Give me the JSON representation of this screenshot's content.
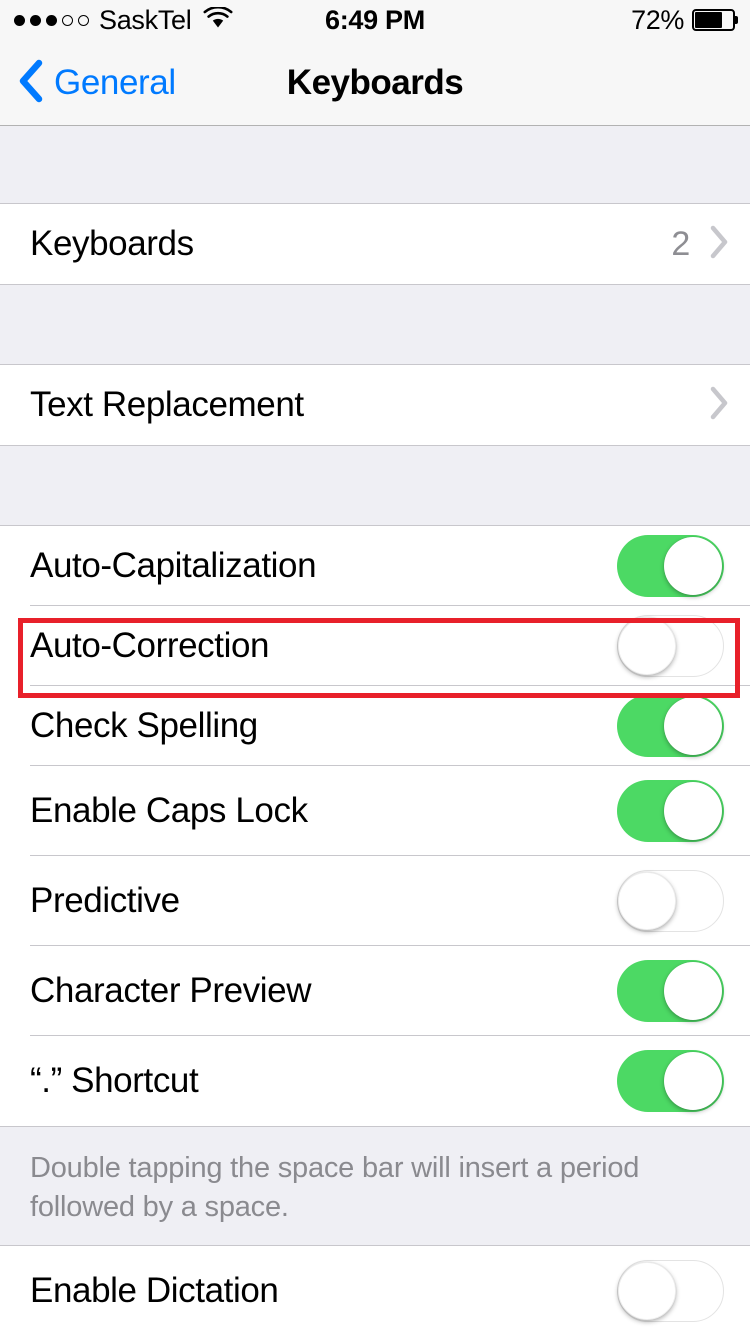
{
  "status_bar": {
    "signal_dots_filled": 3,
    "signal_dots_total": 5,
    "carrier": "SaskTel",
    "wifi_icon": "wifi-icon",
    "time": "6:49 PM",
    "battery_percent": "72%",
    "battery_level": 72
  },
  "nav": {
    "back_label": "General",
    "back_icon": "chevron-left-icon",
    "title": "Keyboards"
  },
  "sections": {
    "keyboards": {
      "label": "Keyboards",
      "value": "2",
      "disclosure_icon": "chevron-right-icon"
    },
    "text_replacement": {
      "label": "Text Replacement",
      "disclosure_icon": "chevron-right-icon"
    },
    "toggles": [
      {
        "label": "Auto-Capitalization",
        "state": "on"
      },
      {
        "label": "Auto-Correction",
        "state": "off",
        "highlighted": true
      },
      {
        "label": "Check Spelling",
        "state": "on"
      },
      {
        "label": "Enable Caps Lock",
        "state": "on"
      },
      {
        "label": "Predictive",
        "state": "off"
      },
      {
        "label": "Character Preview",
        "state": "on"
      },
      {
        "label": "“.” Shortcut",
        "state": "on"
      }
    ],
    "footer_note": "Double tapping the space bar will insert a period followed by a space.",
    "dictation": [
      {
        "label": "Enable Dictation",
        "state": "off"
      }
    ]
  },
  "colors": {
    "accent_blue": "#007AFF",
    "toggle_on_green": "#4CD964",
    "highlight_red": "#E8202A",
    "group_background": "#EFEFF4",
    "row_background": "#FFFFFF",
    "separator": "#C8C7CC",
    "secondary_text": "#8E8E93"
  }
}
